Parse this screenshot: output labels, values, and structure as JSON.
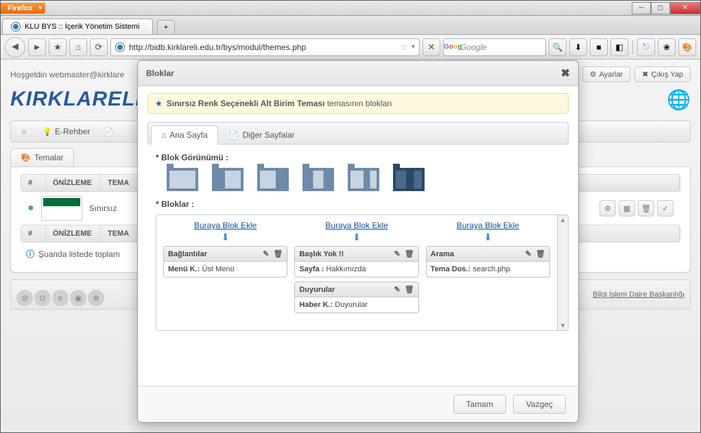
{
  "browser": {
    "name": "Firefox",
    "tab_title": "KLU BYS :: İçerik Yönetim Sistemi",
    "url": "http://bidb.kirklareli.edu.tr/bys/modul/themes.php",
    "search_placeholder": "Google"
  },
  "page": {
    "welcome": "Hoşgeldin webmaster@kirklare",
    "btn_settings": "Ayarlar",
    "btn_logout": "Çıkış Yap",
    "logo": "KIRKLARELİ",
    "nav": {
      "erehber": "E-Rehber"
    },
    "sub_tab": "Temalar",
    "table": {
      "col_num": "#",
      "col_preview": "ÖNİZLEME",
      "col_theme": "TEMA",
      "row_name": "Sınırsız"
    },
    "info_text": "Şuanda listede toplam",
    "footer_link": "Bilgi İşlem Daire Başkanlığı"
  },
  "dialog": {
    "title": "Bloklar",
    "banner_bold": "Sınırsız Renk Seçenekli Alt Birim Teması",
    "banner_rest": " temasının blokları",
    "tab1": "Ana Sayfa",
    "tab2": "Diğer Sayfalar",
    "section_layout": "* Blok Görünümü :",
    "section_blocks": "* Bloklar :",
    "add_link": "Buraya Blok Ekle",
    "col1": {
      "block1_title": "Bağlantılar",
      "block1_key": "Menü K.:",
      "block1_val": " Üst Menü"
    },
    "col2": {
      "block1_title": "Başlık Yok !!",
      "block1_key": "Sayfa :",
      "block1_val": " Hakkımızda",
      "block2_title": "Duyurular",
      "block2_key": "Haber K.:",
      "block2_val": " Duyurular"
    },
    "col3": {
      "block1_title": "Arama",
      "block1_key": "Tema Dos.:",
      "block1_val": " search.php"
    },
    "btn_ok": "Tamam",
    "btn_cancel": "Vazgeç"
  }
}
